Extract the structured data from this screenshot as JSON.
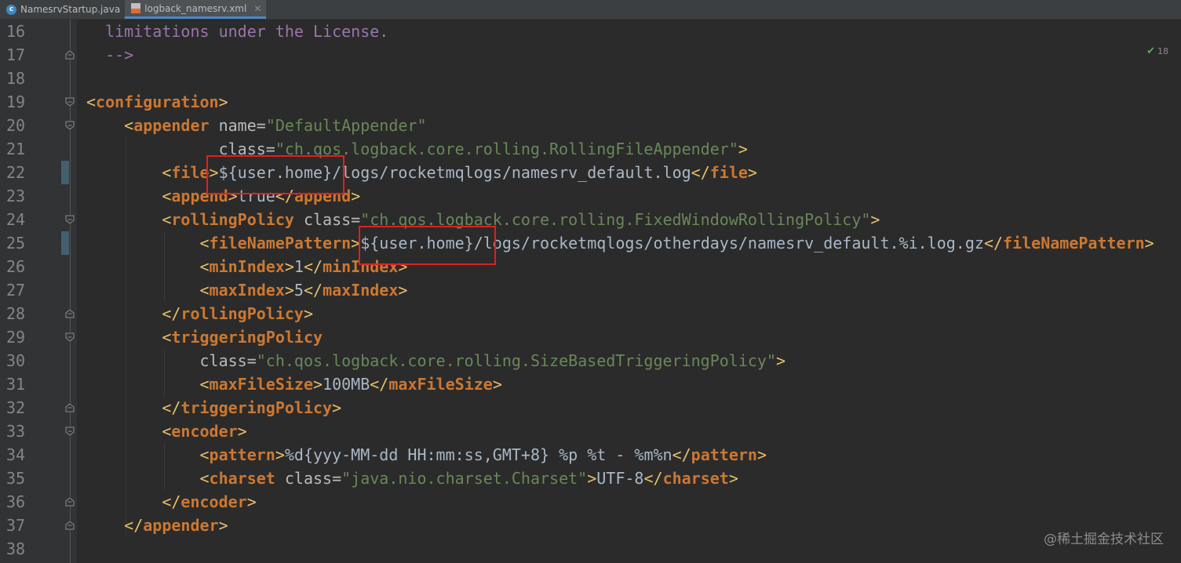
{
  "tabs": [
    {
      "label": "NamesrvStartup.java",
      "icon": "java-class-icon",
      "active": false
    },
    {
      "label": "logback_namesrv.xml",
      "icon": "xml-file-icon",
      "active": true
    }
  ],
  "inspection": {
    "count": "18",
    "icon": "check-icon"
  },
  "watermark": "@稀土掘金技术社区",
  "line_numbers": [
    "16",
    "17",
    "18",
    "19",
    "20",
    "21",
    "22",
    "23",
    "24",
    "25",
    "26",
    "27",
    "28",
    "29",
    "30",
    "31",
    "32",
    "33",
    "34",
    "35",
    "36",
    "37",
    "38"
  ],
  "code_lines": [
    [
      {
        "t": "comment",
        "v": "  limitations under the License."
      }
    ],
    [
      {
        "t": "comment",
        "v": "  -->"
      }
    ],
    [],
    [
      {
        "t": "bracket",
        "v": "<"
      },
      {
        "t": "tag",
        "v": "configuration"
      },
      {
        "t": "bracket",
        "v": ">"
      }
    ],
    [
      {
        "t": "text",
        "v": "    "
      },
      {
        "t": "bracket",
        "v": "<"
      },
      {
        "t": "tag",
        "v": "appender "
      },
      {
        "t": "attr",
        "v": "name="
      },
      {
        "t": "val",
        "v": "\"DefaultAppender\""
      }
    ],
    [
      {
        "t": "text",
        "v": "              "
      },
      {
        "t": "attr",
        "v": "class="
      },
      {
        "t": "val",
        "v": "\"ch.qos.logback.core.rolling.RollingFileAppender\""
      },
      {
        "t": "bracket",
        "v": ">"
      }
    ],
    [
      {
        "t": "text",
        "v": "        "
      },
      {
        "t": "bracket",
        "v": "<"
      },
      {
        "t": "tag",
        "v": "file"
      },
      {
        "t": "bracket",
        "v": ">"
      },
      {
        "t": "text",
        "v": "${user.home}/logs/rocketmqlogs/namesrv_default.log"
      },
      {
        "t": "bracket",
        "v": "</"
      },
      {
        "t": "tag",
        "v": "file"
      },
      {
        "t": "bracket",
        "v": ">"
      }
    ],
    [
      {
        "t": "text",
        "v": "        "
      },
      {
        "t": "bracket",
        "v": "<"
      },
      {
        "t": "tag",
        "v": "append"
      },
      {
        "t": "bracket",
        "v": ">"
      },
      {
        "t": "text",
        "v": "true"
      },
      {
        "t": "bracket",
        "v": "</"
      },
      {
        "t": "tag",
        "v": "append"
      },
      {
        "t": "bracket",
        "v": ">"
      }
    ],
    [
      {
        "t": "text",
        "v": "        "
      },
      {
        "t": "bracket",
        "v": "<"
      },
      {
        "t": "tag",
        "v": "rollingPolicy "
      },
      {
        "t": "attr",
        "v": "class="
      },
      {
        "t": "val",
        "v": "\"ch.qos.logback.core.rolling.FixedWindowRollingPolicy\""
      },
      {
        "t": "bracket",
        "v": ">"
      }
    ],
    [
      {
        "t": "text",
        "v": "            "
      },
      {
        "t": "bracket",
        "v": "<"
      },
      {
        "t": "tag",
        "v": "fileNamePattern"
      },
      {
        "t": "bracket",
        "v": ">"
      },
      {
        "t": "text",
        "v": "${user.home}/logs/rocketmqlogs/otherdays/namesrv_default.%i.log.gz"
      },
      {
        "t": "bracket",
        "v": "</"
      },
      {
        "t": "tag",
        "v": "fileNamePattern"
      },
      {
        "t": "bracket",
        "v": ">"
      }
    ],
    [
      {
        "t": "text",
        "v": "            "
      },
      {
        "t": "bracket",
        "v": "<"
      },
      {
        "t": "tag",
        "v": "minIndex"
      },
      {
        "t": "bracket",
        "v": ">"
      },
      {
        "t": "text",
        "v": "1"
      },
      {
        "t": "bracket",
        "v": "</"
      },
      {
        "t": "tag",
        "v": "minIndex"
      },
      {
        "t": "bracket",
        "v": ">"
      }
    ],
    [
      {
        "t": "text",
        "v": "            "
      },
      {
        "t": "bracket",
        "v": "<"
      },
      {
        "t": "tag",
        "v": "maxIndex"
      },
      {
        "t": "bracket",
        "v": ">"
      },
      {
        "t": "text",
        "v": "5"
      },
      {
        "t": "bracket",
        "v": "</"
      },
      {
        "t": "tag",
        "v": "maxIndex"
      },
      {
        "t": "bracket",
        "v": ">"
      }
    ],
    [
      {
        "t": "text",
        "v": "        "
      },
      {
        "t": "bracket",
        "v": "</"
      },
      {
        "t": "tag",
        "v": "rollingPolicy"
      },
      {
        "t": "bracket",
        "v": ">"
      }
    ],
    [
      {
        "t": "text",
        "v": "        "
      },
      {
        "t": "bracket",
        "v": "<"
      },
      {
        "t": "tag",
        "v": "triggeringPolicy"
      }
    ],
    [
      {
        "t": "text",
        "v": "            "
      },
      {
        "t": "attr",
        "v": "class="
      },
      {
        "t": "val",
        "v": "\"ch.qos.logback.core.rolling.SizeBasedTriggeringPolicy\""
      },
      {
        "t": "bracket",
        "v": ">"
      }
    ],
    [
      {
        "t": "text",
        "v": "            "
      },
      {
        "t": "bracket",
        "v": "<"
      },
      {
        "t": "tag",
        "v": "maxFileSize"
      },
      {
        "t": "bracket",
        "v": ">"
      },
      {
        "t": "text",
        "v": "100MB"
      },
      {
        "t": "bracket",
        "v": "</"
      },
      {
        "t": "tag",
        "v": "maxFileSize"
      },
      {
        "t": "bracket",
        "v": ">"
      }
    ],
    [
      {
        "t": "text",
        "v": "        "
      },
      {
        "t": "bracket",
        "v": "</"
      },
      {
        "t": "tag",
        "v": "triggeringPolicy"
      },
      {
        "t": "bracket",
        "v": ">"
      }
    ],
    [
      {
        "t": "text",
        "v": "        "
      },
      {
        "t": "bracket",
        "v": "<"
      },
      {
        "t": "tag",
        "v": "encoder"
      },
      {
        "t": "bracket",
        "v": ">"
      }
    ],
    [
      {
        "t": "text",
        "v": "            "
      },
      {
        "t": "bracket",
        "v": "<"
      },
      {
        "t": "tag",
        "v": "pattern"
      },
      {
        "t": "bracket",
        "v": ">"
      },
      {
        "t": "text",
        "v": "%d{yyy-MM-dd HH:mm:ss,GMT+8} %p %t - %m%n"
      },
      {
        "t": "bracket",
        "v": "</"
      },
      {
        "t": "tag",
        "v": "pattern"
      },
      {
        "t": "bracket",
        "v": ">"
      }
    ],
    [
      {
        "t": "text",
        "v": "            "
      },
      {
        "t": "bracket",
        "v": "<"
      },
      {
        "t": "tag",
        "v": "charset "
      },
      {
        "t": "attr",
        "v": "class="
      },
      {
        "t": "val",
        "v": "\"java.nio.charset.Charset\""
      },
      {
        "t": "bracket",
        "v": ">"
      },
      {
        "t": "text",
        "v": "UTF-8"
      },
      {
        "t": "bracket",
        "v": "</"
      },
      {
        "t": "tag",
        "v": "charset"
      },
      {
        "t": "bracket",
        "v": ">"
      }
    ],
    [
      {
        "t": "text",
        "v": "        "
      },
      {
        "t": "bracket",
        "v": "</"
      },
      {
        "t": "tag",
        "v": "encoder"
      },
      {
        "t": "bracket",
        "v": ">"
      }
    ],
    [
      {
        "t": "text",
        "v": "    "
      },
      {
        "t": "bracket",
        "v": "</"
      },
      {
        "t": "tag",
        "v": "appender"
      },
      {
        "t": "bracket",
        "v": ">"
      }
    ],
    []
  ],
  "colors": {
    "background": "#2b2b2b",
    "gutter": "#313335",
    "comment": "#9876aa",
    "tag": "#cc7832",
    "bracket": "#e8bf6a",
    "attribute": "#bababa",
    "value": "#6a8759",
    "text": "#a9b7c6",
    "highlight_box": "#e02020"
  }
}
